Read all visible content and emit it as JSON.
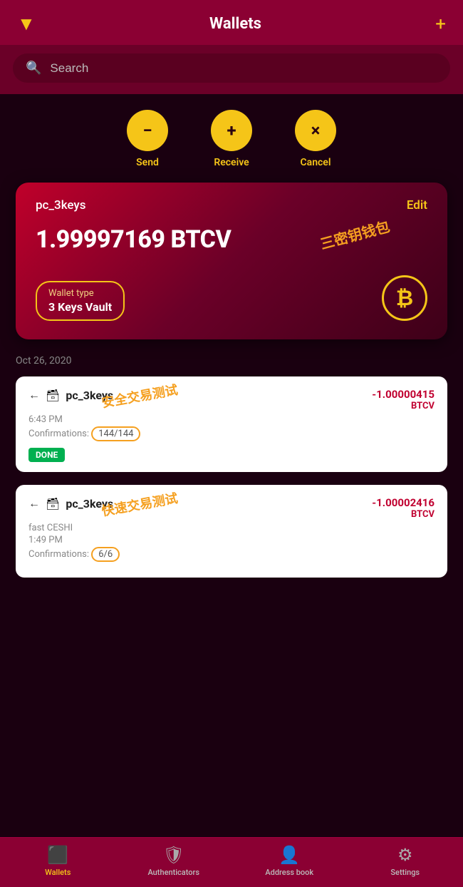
{
  "header": {
    "title": "Wallets",
    "filter_icon": "▼",
    "add_icon": "+"
  },
  "search": {
    "placeholder": "Search"
  },
  "actions": [
    {
      "id": "send",
      "icon": "−",
      "label": "Send"
    },
    {
      "id": "receive",
      "icon": "+",
      "label": "Receive"
    },
    {
      "id": "cancel",
      "icon": "×",
      "label": "Cancel"
    }
  ],
  "wallet_card": {
    "name": "pc_3keys",
    "edit_label": "Edit",
    "balance": "1.99997169 BTCV",
    "wallet_type_label": "Wallet type",
    "wallet_type_value": "3 Keys Vault",
    "annotation": "三密钥钱包",
    "btc_symbol": "₿"
  },
  "transactions": {
    "date": "Oct 26, 2020",
    "items": [
      {
        "id": "tx1",
        "arrow": "←",
        "wallet_icon": "🗂",
        "name": "pc_3keys",
        "annotation": "安全交易测试",
        "time": "6:43 PM",
        "confirmations": "Confirmations: 144/144",
        "confirmations_short": "144/144",
        "amount": "-1.00000415",
        "unit": "BTCV",
        "status": "DONE"
      },
      {
        "id": "tx2",
        "arrow": "←",
        "wallet_icon": "🗂",
        "name": "pc_3keys",
        "annotation": "快速交易测试",
        "label_prefix": "fast CESHI",
        "time": "1:49 PM",
        "confirmations": "Confirmations: 6/6",
        "confirmations_short": "6/6",
        "amount": "-1.00002416",
        "unit": "BTCV",
        "status": ""
      }
    ]
  },
  "bottom_nav": {
    "items": [
      {
        "id": "wallets",
        "icon": "▣",
        "label": "Wallets",
        "active": true
      },
      {
        "id": "authenticators",
        "icon": "🛡",
        "label": "Authenticators",
        "active": false
      },
      {
        "id": "address_book",
        "icon": "👤",
        "label": "Address book",
        "active": false
      },
      {
        "id": "settings",
        "icon": "⚙",
        "label": "Settings",
        "active": false
      }
    ]
  }
}
